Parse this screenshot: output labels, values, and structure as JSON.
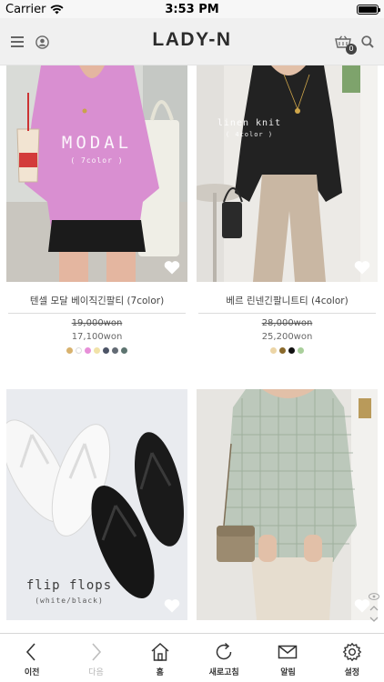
{
  "status_bar": {
    "carrier": "Carrier",
    "time": "3:53 PM",
    "battery_level": 1.0
  },
  "header": {
    "logo": "LADY-N",
    "cart_count": "0",
    "icons": [
      "menu-icon",
      "account-icon",
      "cart-icon",
      "search-icon"
    ]
  },
  "products": [
    {
      "name": "텐셀 모달 베이직긴팔티 (7color)",
      "original_price": "19,000won",
      "sale_price": "17,100won",
      "photo_title": "MODAL",
      "photo_subtitle": "( 7color )",
      "swatches": [
        "#d8b26e",
        "#ffffff",
        "#e78fd8",
        "#f1e2a8",
        "#4c5466",
        "#636b74",
        "#5d7470"
      ]
    },
    {
      "name": "베르 린넨긴팔니트티 (4color)",
      "original_price": "28,000won",
      "sale_price": "25,200won",
      "photo_title": "linen knit",
      "photo_subtitle": "( 4color )",
      "swatches": [
        "#ecd5a6",
        "#8a6a2c",
        "#111111",
        "#a9cf9b"
      ]
    },
    {
      "photo_title": "flip flops",
      "photo_subtitle": "(white/black)"
    },
    {}
  ],
  "bottom_nav": [
    {
      "label": "이전",
      "icon": "back-arrow-icon",
      "enabled": true
    },
    {
      "label": "다음",
      "icon": "forward-arrow-icon",
      "enabled": false
    },
    {
      "label": "홈",
      "icon": "home-icon",
      "enabled": true
    },
    {
      "label": "새로고침",
      "icon": "refresh-icon",
      "enabled": true
    },
    {
      "label": "알림",
      "icon": "mail-icon",
      "enabled": true
    },
    {
      "label": "설정",
      "icon": "settings-icon",
      "enabled": true
    }
  ]
}
